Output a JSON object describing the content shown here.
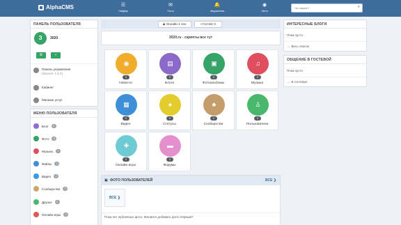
{
  "header": {
    "logo_text": "AlphaCMS",
    "nav": [
      {
        "icon": "menu-icon",
        "glyph": "☰",
        "label": "Сайдбар"
      },
      {
        "icon": "mail-icon",
        "glyph": "✉",
        "label": "Почта"
      },
      {
        "icon": "bell-icon",
        "glyph": "🔔",
        "label": "Уведомления"
      },
      {
        "icon": "rss-icon",
        "glyph": "◉",
        "label": "Лента"
      }
    ],
    "search_placeholder": "Что ищем?"
  },
  "user_panel": {
    "title": "ПАНЕЛЬ ПОЛЬЗОВАТЕЛЯ",
    "avatar_letter": "З",
    "username": "3020",
    "links": [
      {
        "line1": "Панель управления",
        "line2": "(версия: 1.5.0)"
      },
      {
        "line1": "Кабинет",
        "line2": ""
      },
      {
        "line1": "Магазин услуг",
        "line2": ""
      }
    ]
  },
  "user_menu": {
    "title": "МЕНЮ ПОЛЬЗОВАТЕЛЯ",
    "items": [
      {
        "label": "Блог",
        "count": "0",
        "color": "#8e6fcf"
      },
      {
        "label": "Фото",
        "count": "0",
        "color": "#35a466"
      },
      {
        "label": "Музыка",
        "count": "0",
        "color": "#e04f5f"
      },
      {
        "label": "Файлы",
        "count": "0",
        "color": "#3e8fd8"
      },
      {
        "label": "Видео",
        "count": "0",
        "color": "#3b9be0"
      },
      {
        "label": "Сообщества",
        "count": "0",
        "color": "#c9a76a"
      },
      {
        "label": "Друзья",
        "count": "0",
        "color": "#49b86d"
      },
      {
        "label": "Онлайн игры",
        "count": "0",
        "color": "#e05a5a"
      }
    ]
  },
  "center": {
    "online": "Онлайн 1 чел.",
    "guests": "Гостей: 0",
    "site_line": "3020.ru - скрипты все тут",
    "tiles": [
      {
        "label": "Новости",
        "count": "0",
        "color": "#f0ad2d",
        "glyph": "◉"
      },
      {
        "label": "Блоги",
        "count": "0",
        "color": "#8b69c8",
        "glyph": "▤"
      },
      {
        "label": "Фотоальбомы",
        "count": "0",
        "color": "#35a466",
        "glyph": "▣"
      },
      {
        "label": "Музыка",
        "count": "0",
        "color": "#e04f5f",
        "glyph": "♫"
      },
      {
        "label": "Видео",
        "count": "0",
        "color": "#3e8fd8",
        "glyph": "▦"
      },
      {
        "label": "Статусы",
        "count": "0",
        "color": "#e5cc2e",
        "glyph": "●"
      },
      {
        "label": "Сообщества",
        "count": "0",
        "color": "#c59d6c",
        "glyph": "♣"
      },
      {
        "label": "Пользователи",
        "count": "0",
        "color": "#49b86d",
        "glyph": "♙"
      },
      {
        "label": "Онлайн игры",
        "count": "0",
        "color": "#6fcbd3",
        "glyph": "✚"
      },
      {
        "label": "Форумы",
        "count": "0",
        "color": "#e58fcf",
        "glyph": "▬"
      }
    ],
    "photos_title": "ФОТО ПОЛЬЗОВАТЕЛЕЙ",
    "photos_all": "ВСЕ",
    "photos_card": "ВСЕ",
    "footer_text": "Пока нет публичных фото. Желаете добавить фото первым?"
  },
  "right": {
    "blogs_title": "ИНТЕРЕСНЫЕ БЛОГИ",
    "blogs_empty": "Пока пусто",
    "blogs_link": "Весь список",
    "guest_title": "ОБЩЕНИЕ В ГОСТЕВОЙ",
    "guest_empty": "Пока пусто",
    "guest_link": "В гостевую"
  },
  "colors": {
    "header": "#3e6d9c",
    "green": "#35a466",
    "section_bar": "#dfe8f3"
  }
}
